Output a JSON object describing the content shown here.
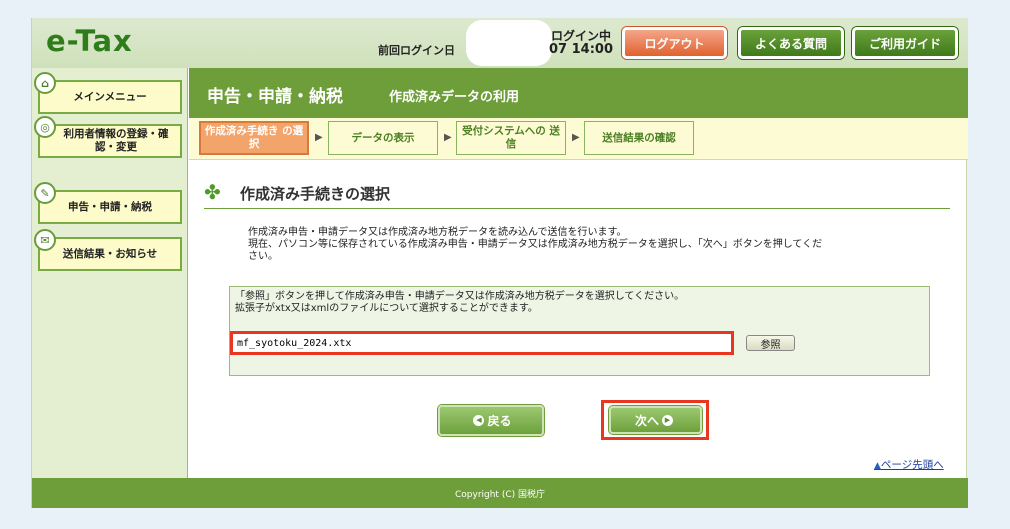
{
  "header": {
    "logo": "e-Tax",
    "login_status": "ログイン中",
    "last_login_label": "前回ログイン日",
    "last_login_time": "07 14:00",
    "logout_label": "ログアウト",
    "faq_label": "よくある質問",
    "guide_label": "ご利用ガイド"
  },
  "sidebar": {
    "items": [
      {
        "label": "メインメニュー",
        "icon": "home-icon"
      },
      {
        "label": "利用者情報の登録・確認・変更",
        "icon": "user-settings-icon"
      },
      {
        "label": "申告・申請・納税",
        "icon": "document-icon"
      },
      {
        "label": "送信結果・お知らせ",
        "icon": "notice-icon"
      }
    ]
  },
  "page": {
    "title": "申告・申請・納税",
    "subtitle": "作成済みデータの利用"
  },
  "steps": [
    {
      "label": "作成済み手続き の選択",
      "active": true
    },
    {
      "label": "データの表示",
      "active": false
    },
    {
      "label": "受付システムへの 送信",
      "active": false
    },
    {
      "label": "送信結果の確認",
      "active": false
    }
  ],
  "section": {
    "title": "作成済み手続きの選択",
    "desc_line1": "作成済み申告・申請データ又は作成済み地方税データを読み込んで送信を行います。",
    "desc_line2": "現在、パソコン等に保存されている作成済み申告・申請データ又は作成済み地方税データを選択し、「次へ」ボタンを押してくだ",
    "desc_line3": "さい。"
  },
  "file_select": {
    "instruction1": "「参照」ボタンを押して作成済み申告・申請データ又は作成済み地方税データを選択してください。",
    "instruction2": "拡張子がxtx又はxmlのファイルについて選択することができます。",
    "value": "mf_syotoku_2024.xtx",
    "browse_label": "参照"
  },
  "buttons": {
    "back_label": "戻る",
    "next_label": "次へ"
  },
  "page_top_label": "ページ先頭へ",
  "footer": "Copyright (C) 国税庁",
  "colors": {
    "brand_green": "#6d9e3a",
    "accent_orange": "#e0622e",
    "highlight_red": "#e8361f"
  }
}
